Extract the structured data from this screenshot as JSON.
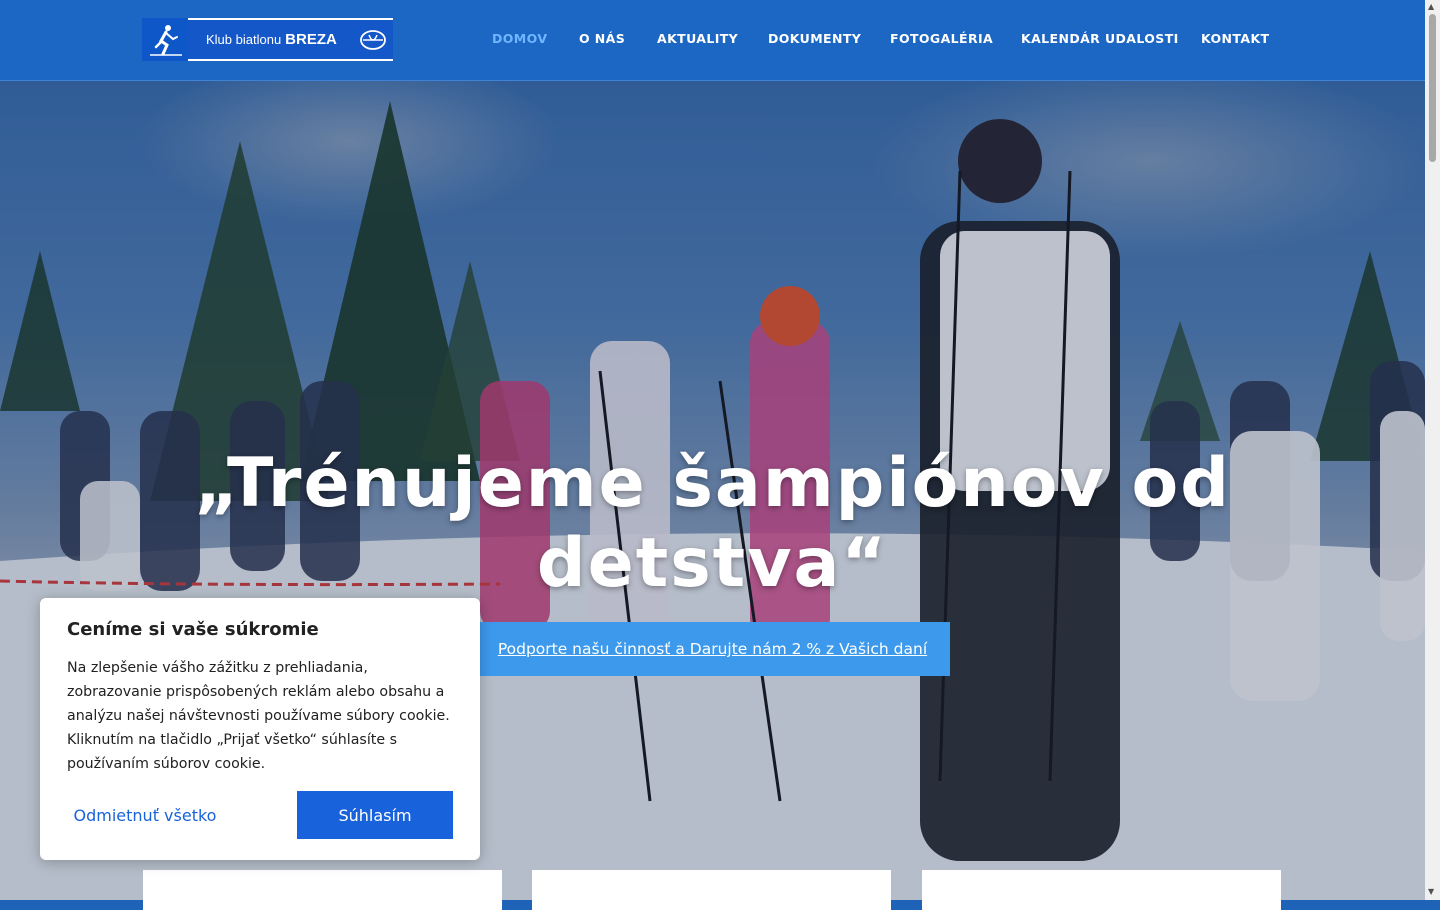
{
  "header": {
    "logo": {
      "prefix": "Klub biatlonu",
      "name": "BREZA"
    },
    "nav": [
      {
        "label": "DOMOV",
        "active": true
      },
      {
        "label": "O NÁS",
        "active": false
      },
      {
        "label": "AKTUALITY",
        "active": false
      },
      {
        "label": "DOKUMENTY",
        "active": false
      },
      {
        "label": "FOTOGALÉRIA",
        "active": false
      },
      {
        "label": "KALENDÁR UDALOSTI",
        "active": false
      },
      {
        "label": "KONTAKT",
        "active": false
      }
    ]
  },
  "hero": {
    "title_line1": "„Trénujeme šampiónov od",
    "title_line2": "detstva“",
    "cta": "Podporte našu činnosť a Darujte nám 2 % z Vašich daní"
  },
  "cookie": {
    "title": "Ceníme si vaše súkromie",
    "text": "Na zlepšenie vášho zážitku z prehliadania, zobrazovanie prispôsobených reklám alebo obsahu a analýzu našej návštevnosti používame súbory cookie. Kliknutím na tlačidlo „Prijať všetko“ súhlasíte s používaním súborov cookie.",
    "reject": "Odmietnuť všetko",
    "accept": "Súhlasím"
  },
  "colors": {
    "header_bg": "#1c66c4",
    "nav_active": "#6fb6ff",
    "cta_bg": "#3c99ec",
    "primary_button": "#1863dc"
  }
}
